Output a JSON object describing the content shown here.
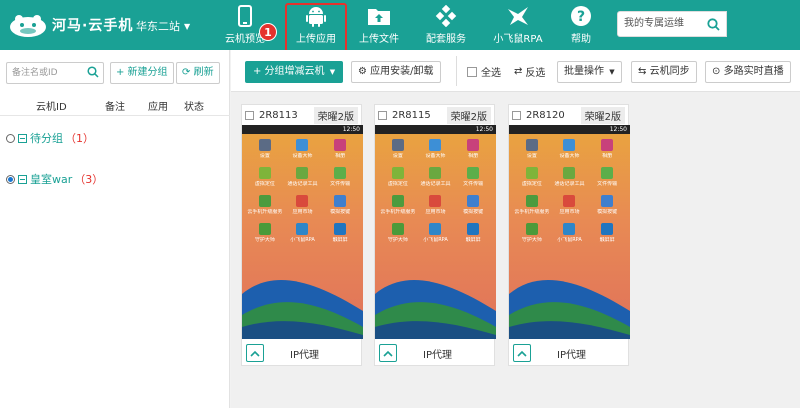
{
  "header": {
    "logo_text": "河马·云手机",
    "region": "华东二站",
    "nav": [
      {
        "label": "云机预览",
        "icon": "phone-icon"
      },
      {
        "label": "上传应用",
        "icon": "android-icon"
      },
      {
        "label": "上传文件",
        "icon": "folder-upload-icon"
      },
      {
        "label": "配套服务",
        "icon": "services-icon"
      },
      {
        "label": "小飞鼠RPA",
        "icon": "rpa-icon"
      },
      {
        "label": "帮助",
        "icon": "help-icon"
      }
    ],
    "badge": "1",
    "search_placeholder": "我的专属运维"
  },
  "sidebar": {
    "search_placeholder": "备注名或ID",
    "add_group": "+ 新建分组",
    "refresh": "刷新",
    "columns": [
      "云机ID",
      "备注",
      "应用",
      "状态"
    ],
    "groups": [
      {
        "name": "待分组",
        "count": "（1）",
        "selected": false
      },
      {
        "name": "皇室war",
        "count": "（3）",
        "selected": true
      }
    ]
  },
  "toolbar": {
    "add_remove": "+ 分组增减云机",
    "install": "应用安装/卸载",
    "select_all": "全选",
    "invert": "反选",
    "batch": "批量操作",
    "sync": "云机同步",
    "live": "多路实时直播"
  },
  "cards": [
    {
      "id": "2R8113",
      "tag": "荣曜2版",
      "time": "12:50",
      "footer": "IP代理"
    },
    {
      "id": "2R8115",
      "tag": "荣曜2版",
      "time": "12:50",
      "footer": "IP代理"
    },
    {
      "id": "2R8120",
      "tag": "荣曜2版",
      "time": "12:50",
      "footer": "IP代理"
    }
  ],
  "apps": [
    {
      "label": "设置",
      "color": "#5b6b85"
    },
    {
      "label": "设备大师",
      "color": "#3d8fd6"
    },
    {
      "label": "相册",
      "color": "#c8417b"
    },
    {
      "label": "虚拟定位",
      "color": "#7fb43a"
    },
    {
      "label": "通话记录工具",
      "color": "#6aa840"
    },
    {
      "label": "文件传输",
      "color": "#5cae4a"
    },
    {
      "label": "云手机升级服务",
      "color": "#4c9b3e"
    },
    {
      "label": "应用市场",
      "color": "#d94a3c"
    },
    {
      "label": "模拟按键",
      "color": "#3f7fce"
    },
    {
      "label": "守护大师",
      "color": "#4b9a3a"
    },
    {
      "label": "小飞鼠RPA",
      "color": "#2e86c9"
    },
    {
      "label": "触屏屏",
      "color": "#1f75c0"
    }
  ]
}
